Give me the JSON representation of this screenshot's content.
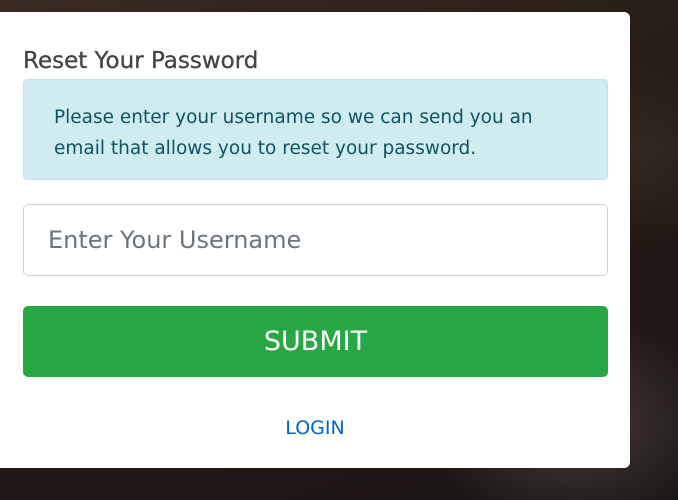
{
  "form": {
    "title": "Reset Your Password",
    "info_message": "Please enter your username so we can send you an email that allows you to reset your password.",
    "username_placeholder": "Enter Your Username",
    "username_value": "",
    "submit_label": "SUBMIT",
    "login_link_label": "LOGIN"
  },
  "colors": {
    "info_background": "#d1ecf1",
    "info_text": "#0c5460",
    "submit_background": "#28a745",
    "link": "#0066cc"
  }
}
